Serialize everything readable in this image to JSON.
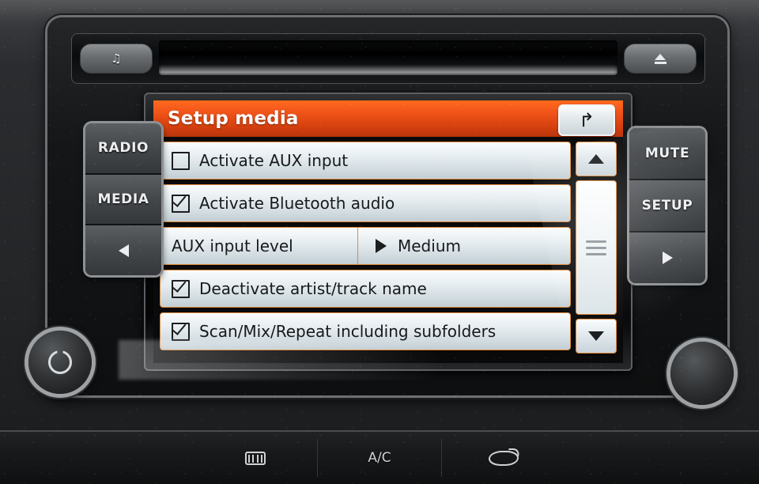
{
  "head_unit": {
    "cd_slot": {
      "music_button_glyph": "♫",
      "music_button_name": "music-note-button",
      "eject_button_name": "eject-button"
    }
  },
  "screen": {
    "title": "Setup media",
    "back_button_glyph": "↰",
    "rows": [
      {
        "type": "checkbox",
        "label": "Activate AUX input",
        "checked": false
      },
      {
        "type": "checkbox",
        "label": "Activate Bluetooth audio",
        "checked": true
      },
      {
        "type": "split",
        "label": "AUX input level",
        "value": "Medium"
      },
      {
        "type": "checkbox",
        "label": "Deactivate artist/track name",
        "checked": true
      },
      {
        "type": "checkbox",
        "label": "Scan/Mix/Repeat including subfolders",
        "checked": true
      }
    ],
    "scrollbar": {
      "up_label": "scroll-up",
      "down_label": "scroll-down",
      "thumb_label": "scroll-thumb"
    },
    "colors": {
      "header_orange": "#f2561a",
      "row_border_orange": "#e08a3c",
      "row_fill": "#e6edf0",
      "text": "#17191b"
    }
  },
  "left_buttons": [
    {
      "label": "RADIO",
      "name": "radio-button"
    },
    {
      "label": "MEDIA",
      "name": "media-button"
    },
    {
      "label": "",
      "name": "previous-button",
      "icon": "triangle-left-icon"
    }
  ],
  "right_buttons": [
    {
      "label": "MUTE",
      "name": "mute-button"
    },
    {
      "label": "SETUP",
      "name": "setup-button"
    },
    {
      "label": "",
      "name": "next-button",
      "icon": "triangle-right-icon"
    }
  ],
  "knobs": {
    "power": "power-volume-knob",
    "tune": "tune-knob"
  },
  "climate": [
    {
      "label": "",
      "name": "rear-defrost-button",
      "icon": "rear-defrost-icon"
    },
    {
      "label": "A/C",
      "name": "ac-button"
    },
    {
      "label": "",
      "name": "air-recirculation-button",
      "icon": "air-recirculation-icon"
    }
  ]
}
